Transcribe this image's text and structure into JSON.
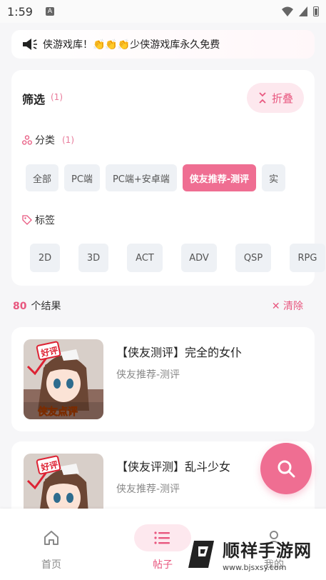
{
  "status_bar": {
    "time": "1:59",
    "notif_letter": "A"
  },
  "announcement": {
    "text": "侠游戏库！👏👏👏少侠游戏库永久免费"
  },
  "filter": {
    "title": "筛选",
    "count": "(1)",
    "collapse_label": "折叠",
    "category": {
      "label": "分类",
      "count": "(1)",
      "items": [
        "全部",
        "PC端",
        "PC端+安卓端",
        "侠友推荐-测评",
        "实"
      ],
      "selected_index": 3
    },
    "tags": {
      "label": "标签",
      "items": [
        "2D",
        "3D",
        "ACT",
        "ADV",
        "QSP",
        "RPG"
      ]
    }
  },
  "results": {
    "count": "80",
    "label": "个结果",
    "clear_label": "清除"
  },
  "posts": [
    {
      "title": "【侠友测评】完全的女仆",
      "category": "侠友推荐-测评",
      "thumb_badge": "好评",
      "thumb_caption": "侠友点评"
    },
    {
      "title": "【侠友评测】乱斗少女",
      "category": "侠友推荐-测评",
      "thumb_badge": "好评",
      "thumb_caption": ""
    }
  ],
  "fab": {
    "icon": "search-icon"
  },
  "bottom_nav": [
    {
      "label": "首页",
      "icon": "home-icon",
      "active": false
    },
    {
      "label": "帖子",
      "icon": "list-icon",
      "active": true
    },
    {
      "label": "我的",
      "icon": "user-icon",
      "active": false
    }
  ],
  "watermark": {
    "title": "顺祥手游网",
    "url": "www.bjsxsy.com"
  },
  "colors": {
    "accent": "#ef6e92",
    "accent_light": "#fde8ee",
    "text": "#222222",
    "muted": "#888888"
  }
}
